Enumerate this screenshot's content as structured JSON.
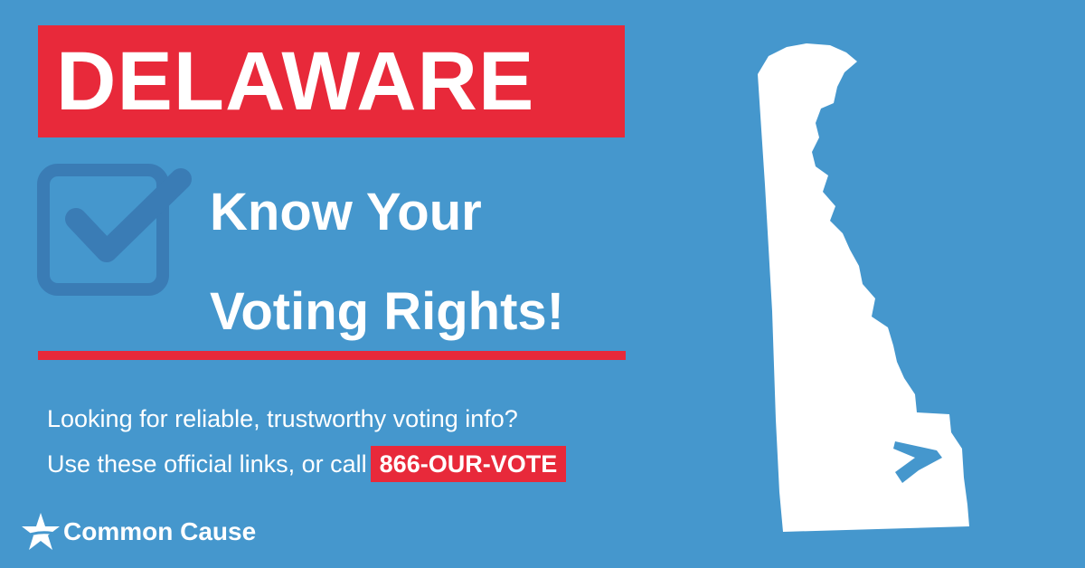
{
  "colors": {
    "background": "#4597cd",
    "accent": "#e8293a",
    "icon_blue": "#3a7cb5",
    "text": "#ffffff"
  },
  "banner": {
    "state": "DELAWARE"
  },
  "headline": {
    "line1": "Know Your",
    "line2": "Voting Rights!"
  },
  "info": {
    "line1": "Looking for reliable, trustworthy voting info?",
    "line2": "Use these official links, or call",
    "phone": "866-OUR-VOTE"
  },
  "logo": {
    "name": "Common Cause",
    "icon": "star-icon"
  },
  "icons": {
    "checkbox": "checkbox-icon",
    "map": "delaware-map"
  }
}
